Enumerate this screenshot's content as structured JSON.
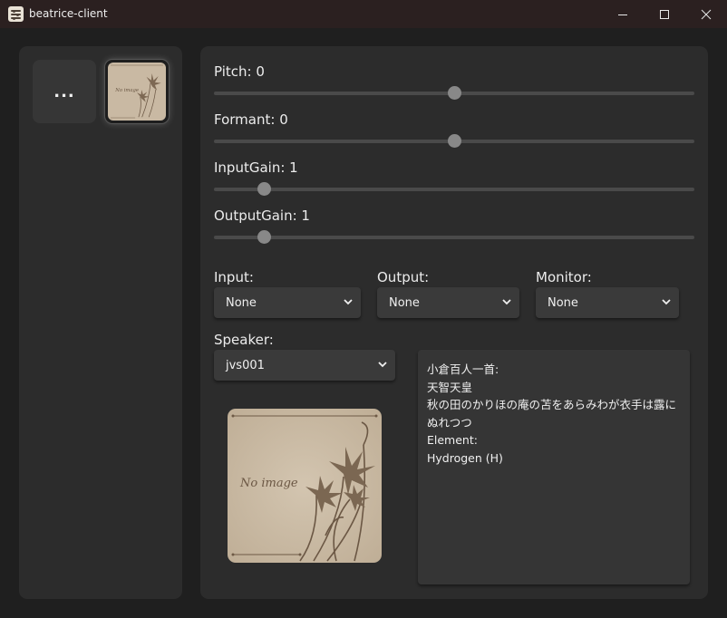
{
  "window": {
    "title": "beatrice-client",
    "icon": "app-icon"
  },
  "sidebar": {
    "more_label": "...",
    "model_thumb_text": "No image"
  },
  "sliders": [
    {
      "label": "Pitch: 0",
      "value_fraction": 0.5
    },
    {
      "label": "Formant: 0",
      "value_fraction": 0.5
    },
    {
      "label": "InputGain: 1",
      "value_fraction": 0.1
    },
    {
      "label": "OutputGain: 1",
      "value_fraction": 0.1
    }
  ],
  "devices": {
    "input": {
      "label": "Input:",
      "value": "None"
    },
    "output": {
      "label": "Output:",
      "value": "None"
    },
    "monitor": {
      "label": "Monitor:",
      "value": "None"
    }
  },
  "speaker": {
    "label": "Speaker:",
    "value": "jvs001",
    "image_text": "No image"
  },
  "info": {
    "lines": [
      "小倉百人一首:",
      "天智天皇",
      "秋の田のかりほの庵の苫をあらみわが衣手は露にぬれつつ",
      "Element:",
      "Hydrogen (H)"
    ]
  },
  "colors": {
    "background": "#1f1f1f",
    "panel": "#2c2c2c",
    "titlebar": "#2b2020",
    "slider_thumb": "#888888",
    "image_paper": "#c8b9a4"
  }
}
